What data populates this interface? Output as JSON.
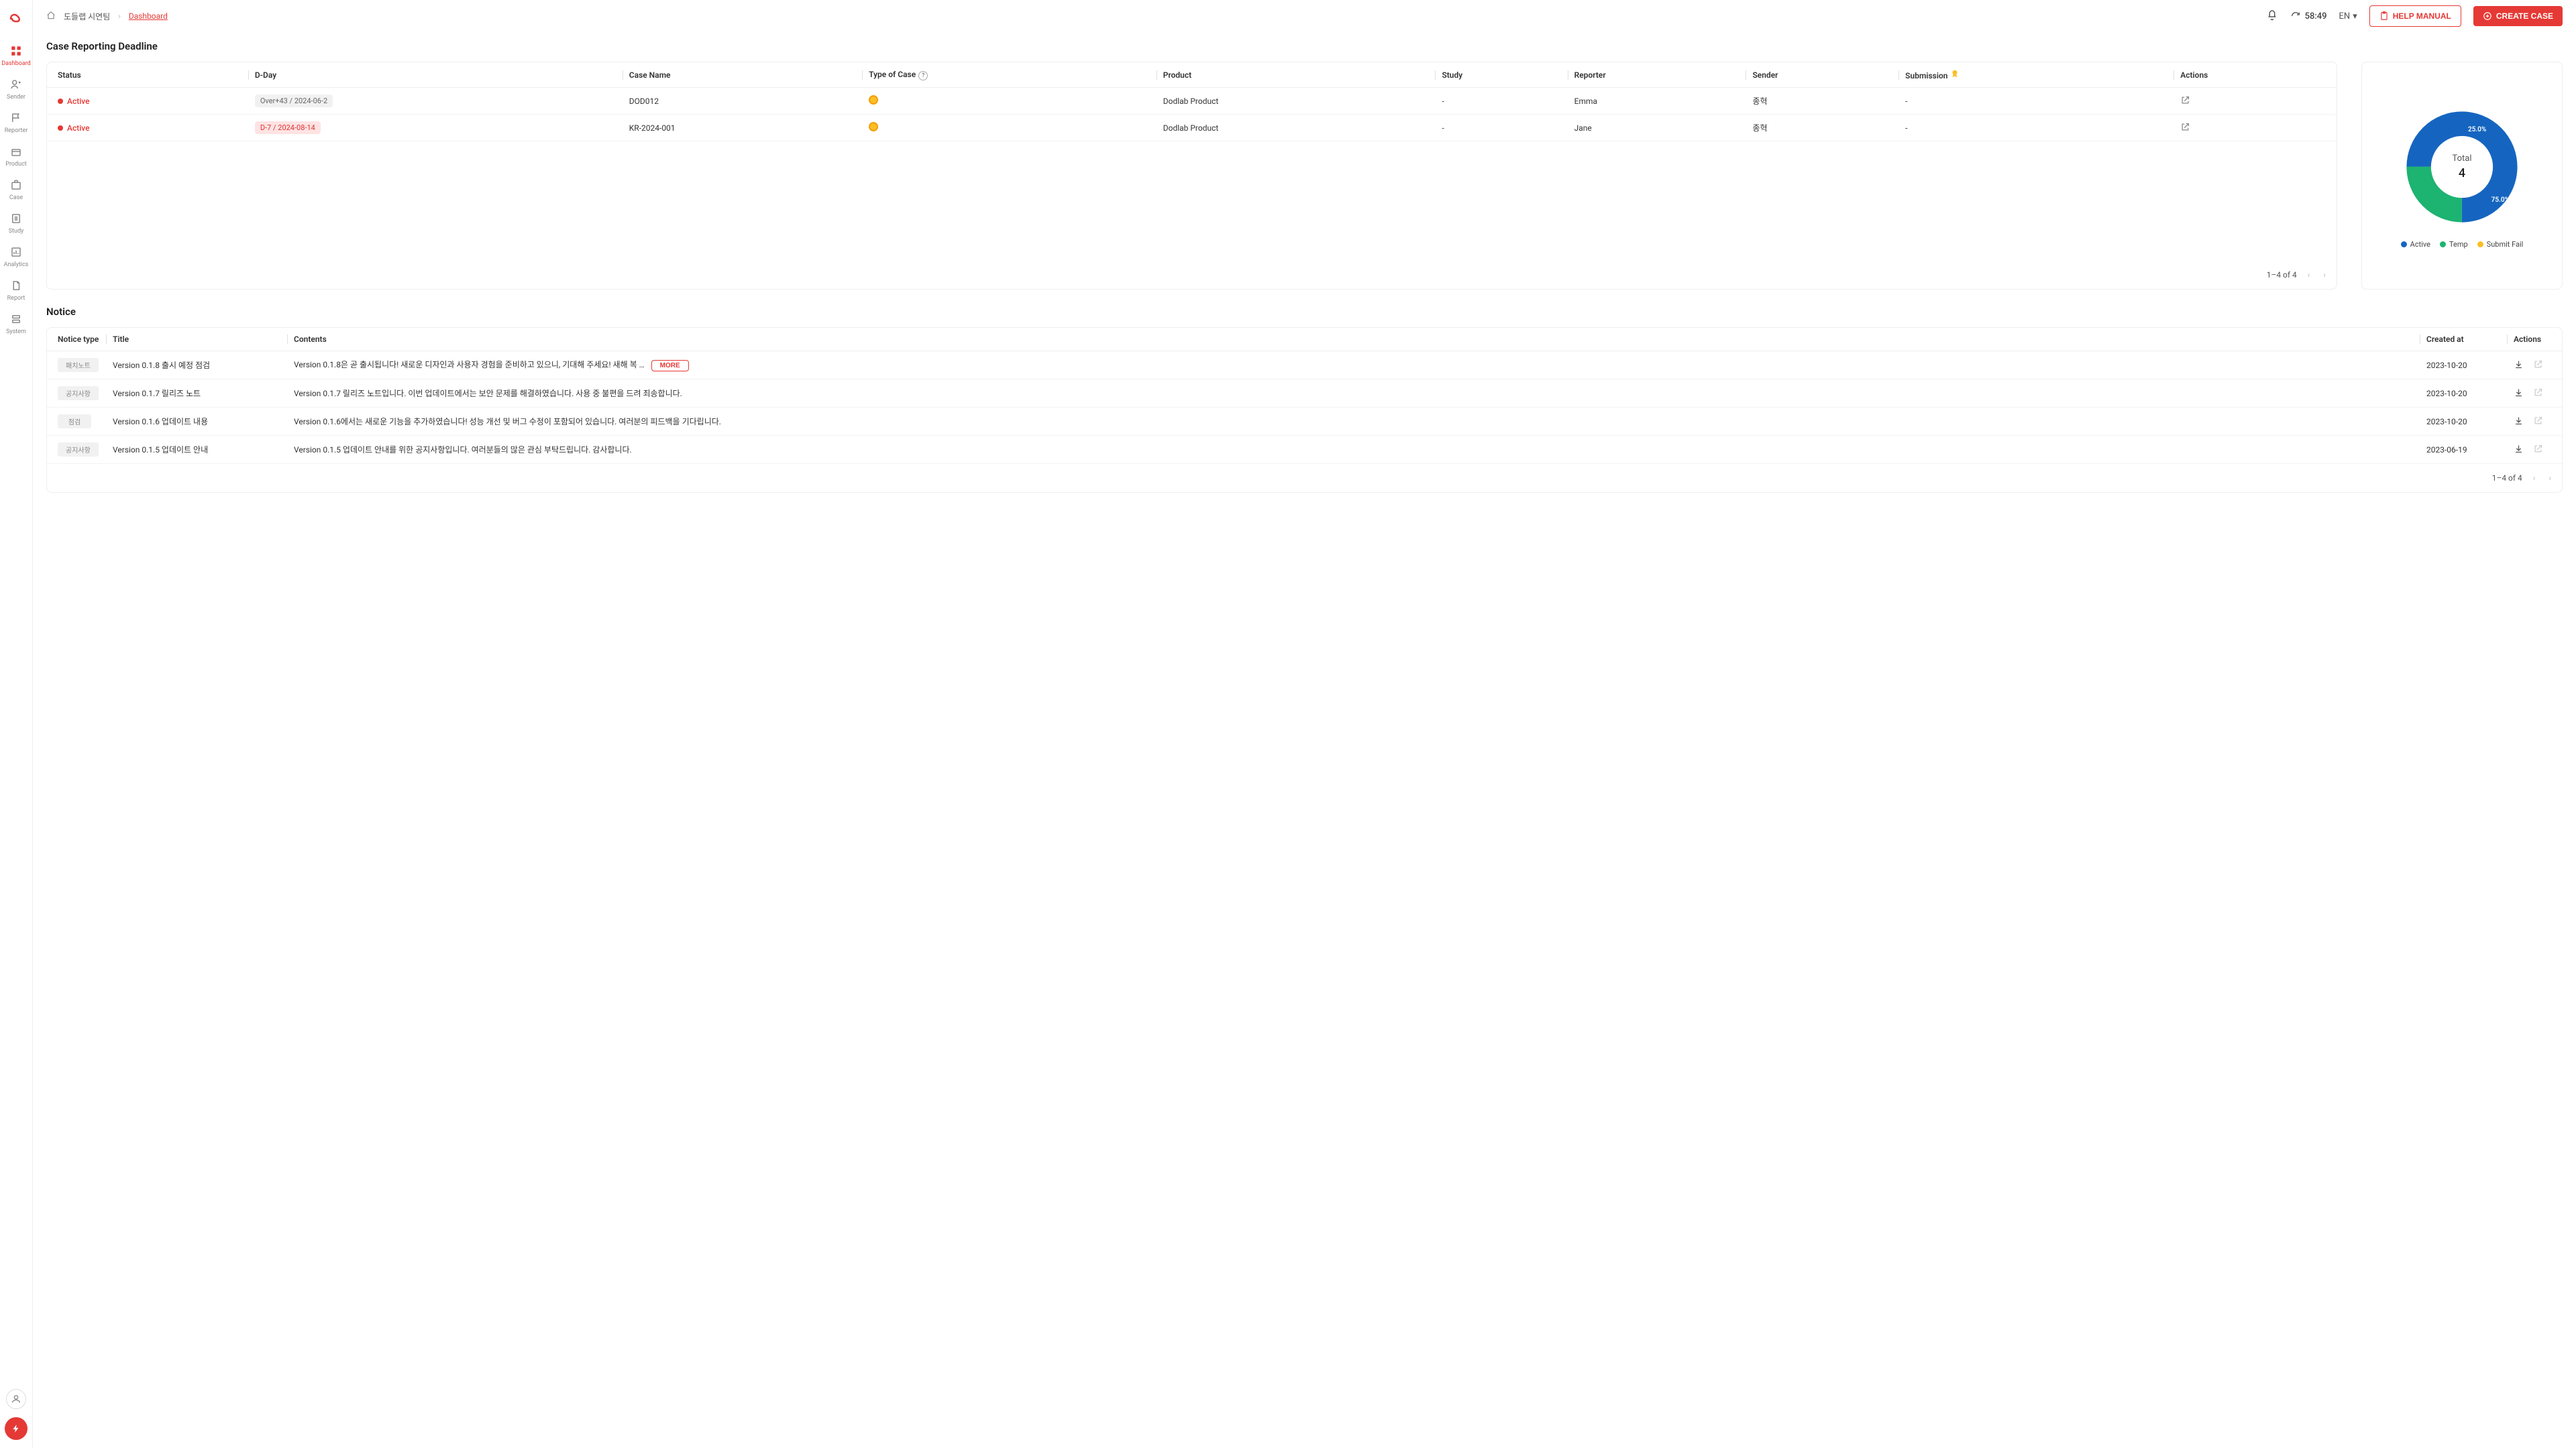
{
  "sidebar": {
    "items": [
      {
        "label": "Dashboard"
      },
      {
        "label": "Sender"
      },
      {
        "label": "Reporter"
      },
      {
        "label": "Product"
      },
      {
        "label": "Case"
      },
      {
        "label": "Study"
      },
      {
        "label": "Analytics"
      },
      {
        "label": "Report"
      },
      {
        "label": "System"
      }
    ]
  },
  "breadcrumb": {
    "org": "도들랩 시연팀",
    "current": "Dashboard"
  },
  "topbar": {
    "timer": "58:49",
    "lang": "EN",
    "help_label": "HELP MANUAL",
    "create_label": "CREATE CASE"
  },
  "sections": {
    "case_title": "Case Reporting Deadline",
    "notice_title": "Notice"
  },
  "case_table": {
    "headers": {
      "status": "Status",
      "dday": "D-Day",
      "case_name": "Case Name",
      "type": "Type of Case",
      "product": "Product",
      "study": "Study",
      "reporter": "Reporter",
      "sender": "Sender",
      "submission": "Submission",
      "actions": "Actions"
    },
    "rows": [
      {
        "status": "Active",
        "dday": "Over+43 / 2024-06-2",
        "dday_warn": false,
        "case_name": "DOD012",
        "product": "Dodlab Product",
        "study": "-",
        "reporter": "Emma",
        "sender": "종혁",
        "submission": "-"
      },
      {
        "status": "Active",
        "dday": "D-7 / 2024-08-14",
        "dday_warn": true,
        "case_name": "KR-2024-001",
        "product": "Dodlab Product",
        "study": "-",
        "reporter": "Jane",
        "sender": "종혁",
        "submission": "-"
      }
    ],
    "pagination": "1–4 of 4"
  },
  "chart_data": {
    "type": "pie",
    "title": "",
    "center_label": "Total",
    "center_value": "4",
    "series": [
      {
        "name": "Active",
        "value": 3,
        "pct": "75.0%",
        "color": "#1565c0"
      },
      {
        "name": "Temp",
        "value": 1,
        "pct": "25.0%",
        "color": "#1db371"
      },
      {
        "name": "Submit Fail",
        "value": 0,
        "pct": "",
        "color": "#fbbf24"
      }
    ]
  },
  "notice_table": {
    "headers": {
      "type": "Notice type",
      "title": "Title",
      "contents": "Contents",
      "created": "Created at",
      "actions": "Actions"
    },
    "more_label": "MORE",
    "rows": [
      {
        "type": "패치노트",
        "title": "Version 0.1.8 출시 예정 점검",
        "contents": "Version 0.1.8은 곧 출시됩니다! 새로운 디자인과 사용자 경험을 준비하고 있으니, 기대해 주세요! 새해 복 …",
        "created": "2023-10-20",
        "has_more": true
      },
      {
        "type": "공지사항",
        "title": "Version 0.1.7 릴리즈 노트",
        "contents": "Version 0.1.7 릴리즈 노트입니다. 이번 업데이트에서는 보안 문제를 해결하였습니다. 사용 중 불편을 드려 죄송합니다.",
        "created": "2023-10-20",
        "has_more": false
      },
      {
        "type": "점검",
        "title": "Version 0.1.6 업데이트 내용",
        "contents": "Version 0.1.6에서는 새로운 기능을 추가하였습니다! 성능 개선 및 버그 수정이 포함되어 있습니다. 여러분의 피드백을 기다립니다.",
        "created": "2023-10-20",
        "has_more": false
      },
      {
        "type": "공지사항",
        "title": "Version 0.1.5 업데이트 안내",
        "contents": "Version 0.1.5 업데이트 안내를 위한 공지사항입니다. 여러분들의 많은 관심 부탁드립니다. 감사합니다.",
        "created": "2023-06-19",
        "has_more": false
      }
    ],
    "pagination": "1–4 of 4"
  }
}
